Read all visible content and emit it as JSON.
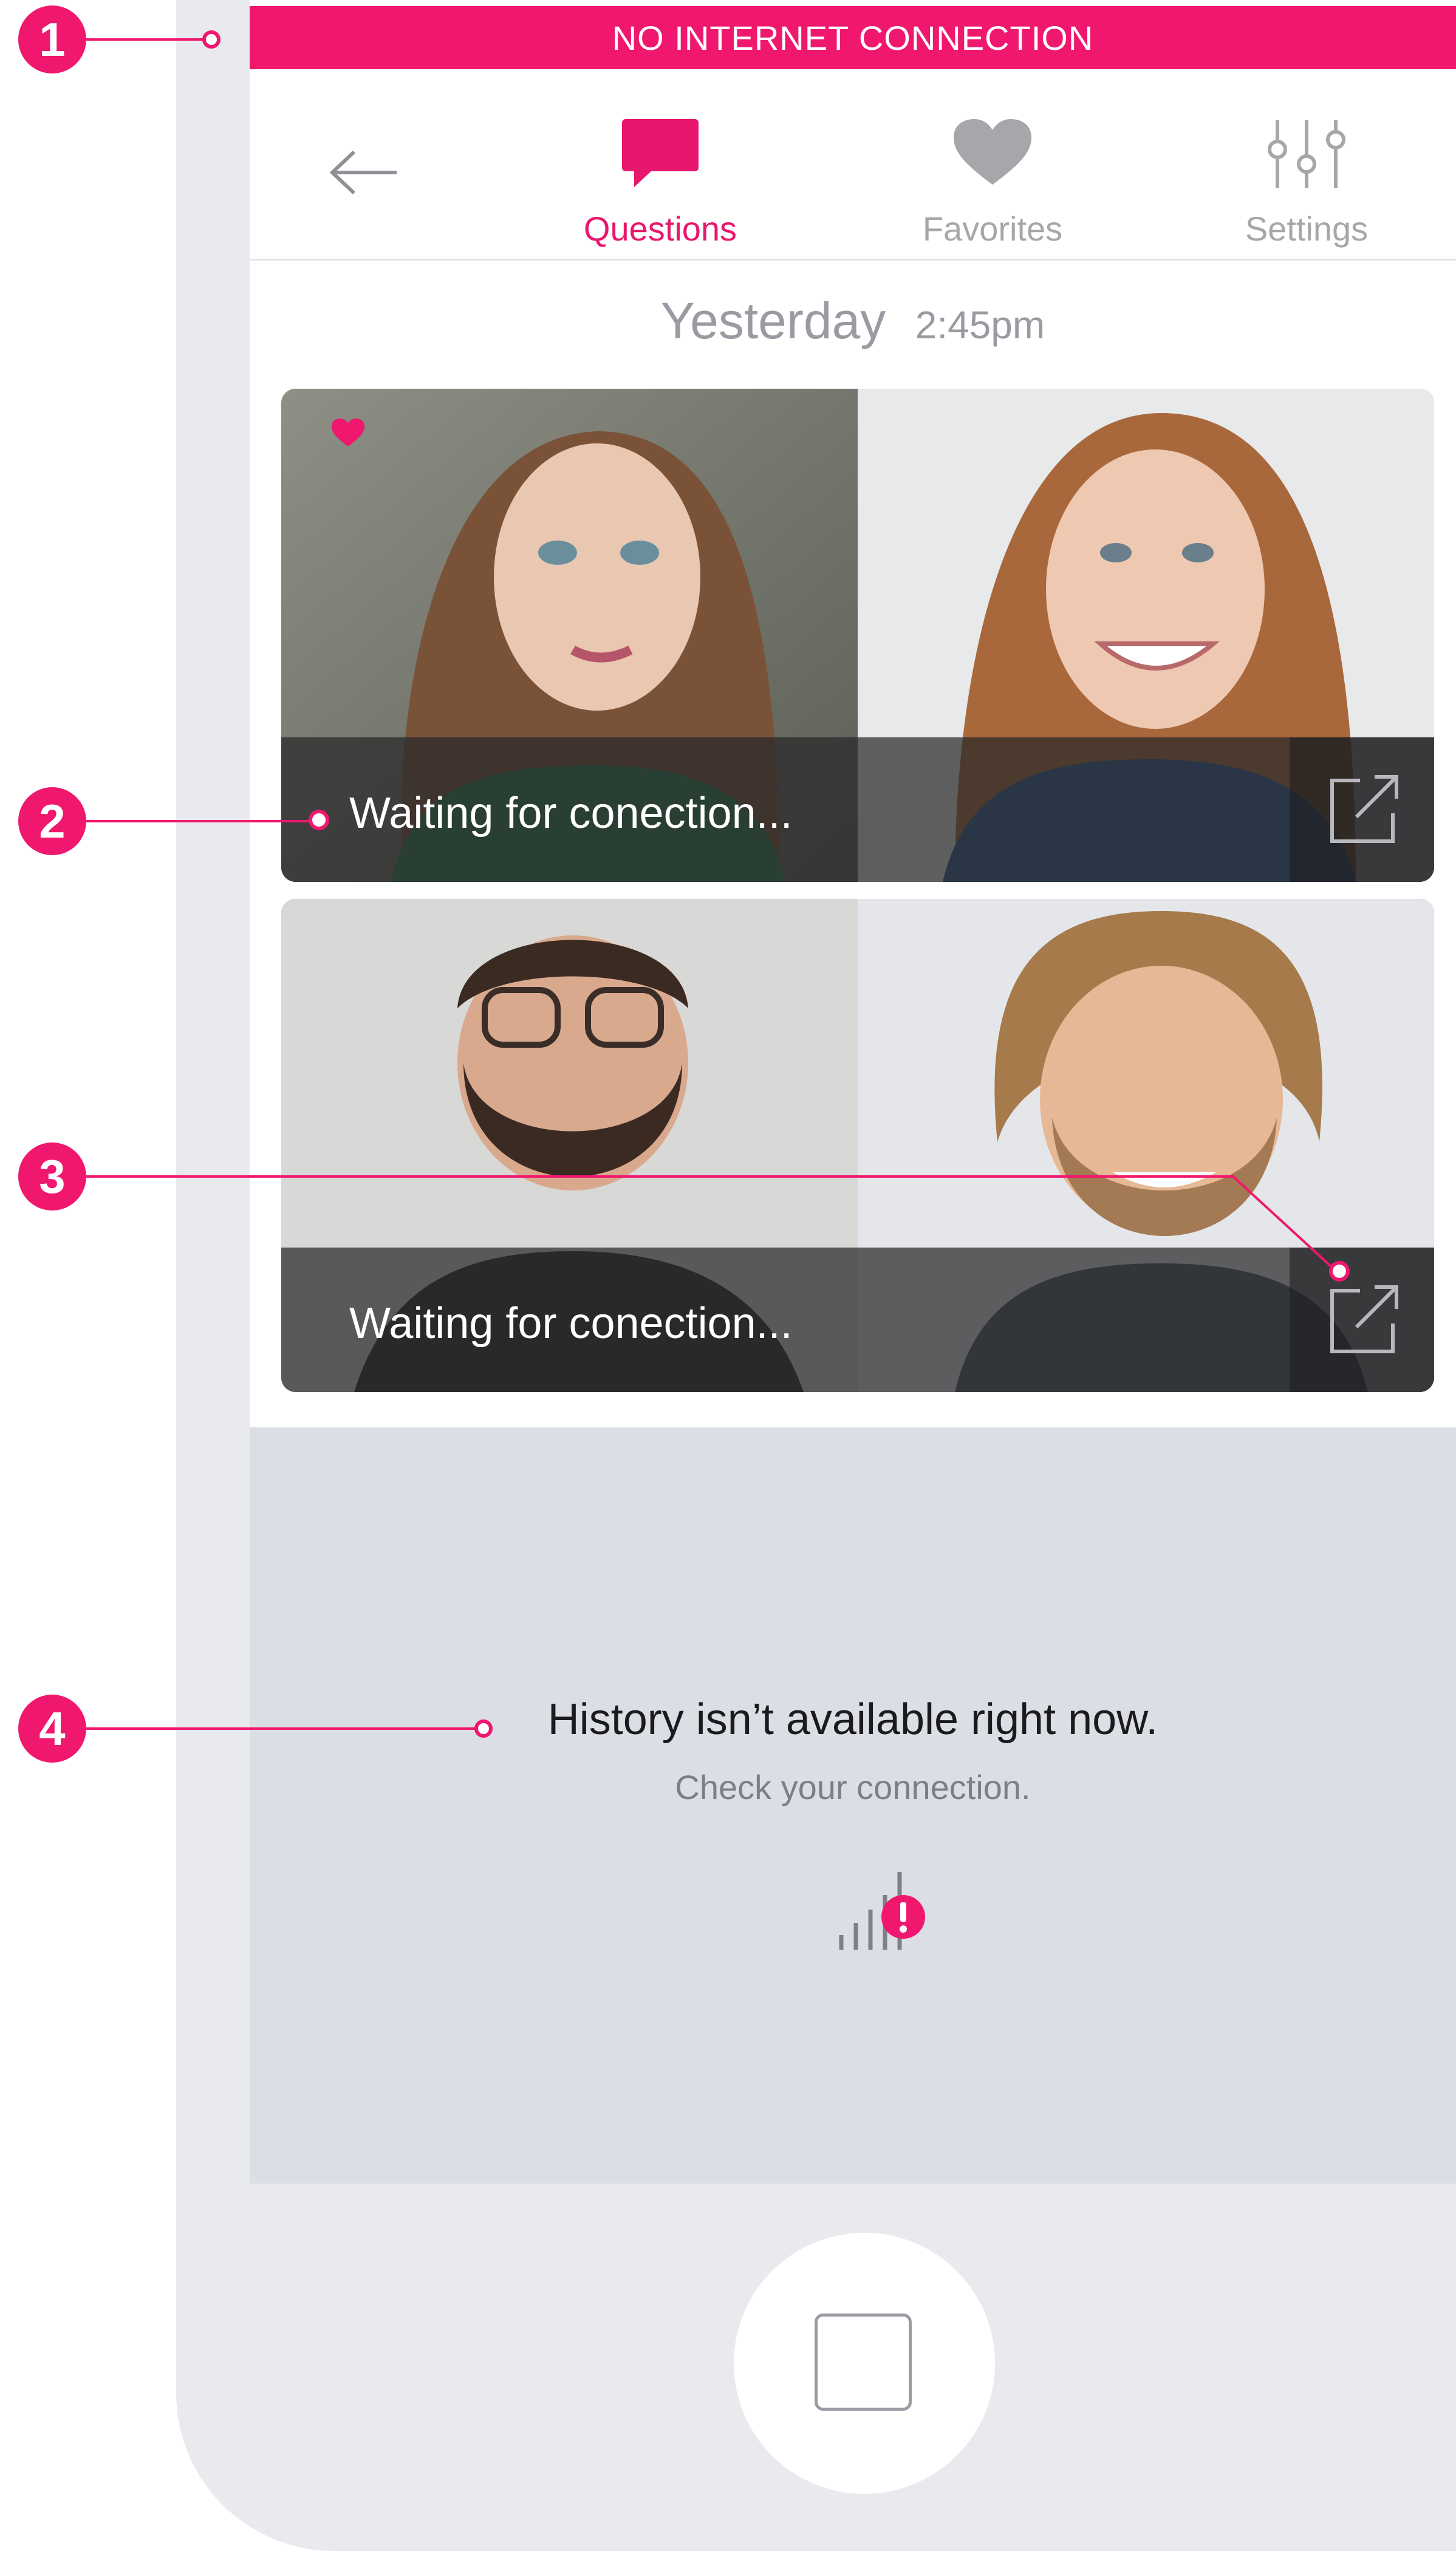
{
  "banner": {
    "text": "NO INTERNET CONNECTION"
  },
  "nav": {
    "back_icon": "arrow-left-icon",
    "tabs": [
      {
        "label": "Questions",
        "icon": "chat-bubble-icon",
        "active": true
      },
      {
        "label": "Favorites",
        "icon": "heart-icon",
        "active": false
      },
      {
        "label": "Settings",
        "icon": "sliders-icon",
        "active": false
      }
    ]
  },
  "feed": {
    "date_day": "Yesterday",
    "date_time": "2:45pm",
    "items": [
      {
        "status": "Waiting for conection...",
        "favorited": true,
        "open_icon": "external-link-icon"
      },
      {
        "status": "Waiting for conection...",
        "favorited": false,
        "open_icon": "external-link-icon"
      }
    ]
  },
  "history": {
    "title": "History isn’t available right now.",
    "subtitle": "Check your connection.",
    "icon": "signal-error-icon"
  },
  "annotations": [
    "1",
    "2",
    "3",
    "4"
  ],
  "colors": {
    "accent": "#f0176e",
    "muted": "#a7a7ab",
    "panel": "#dcdee5"
  }
}
